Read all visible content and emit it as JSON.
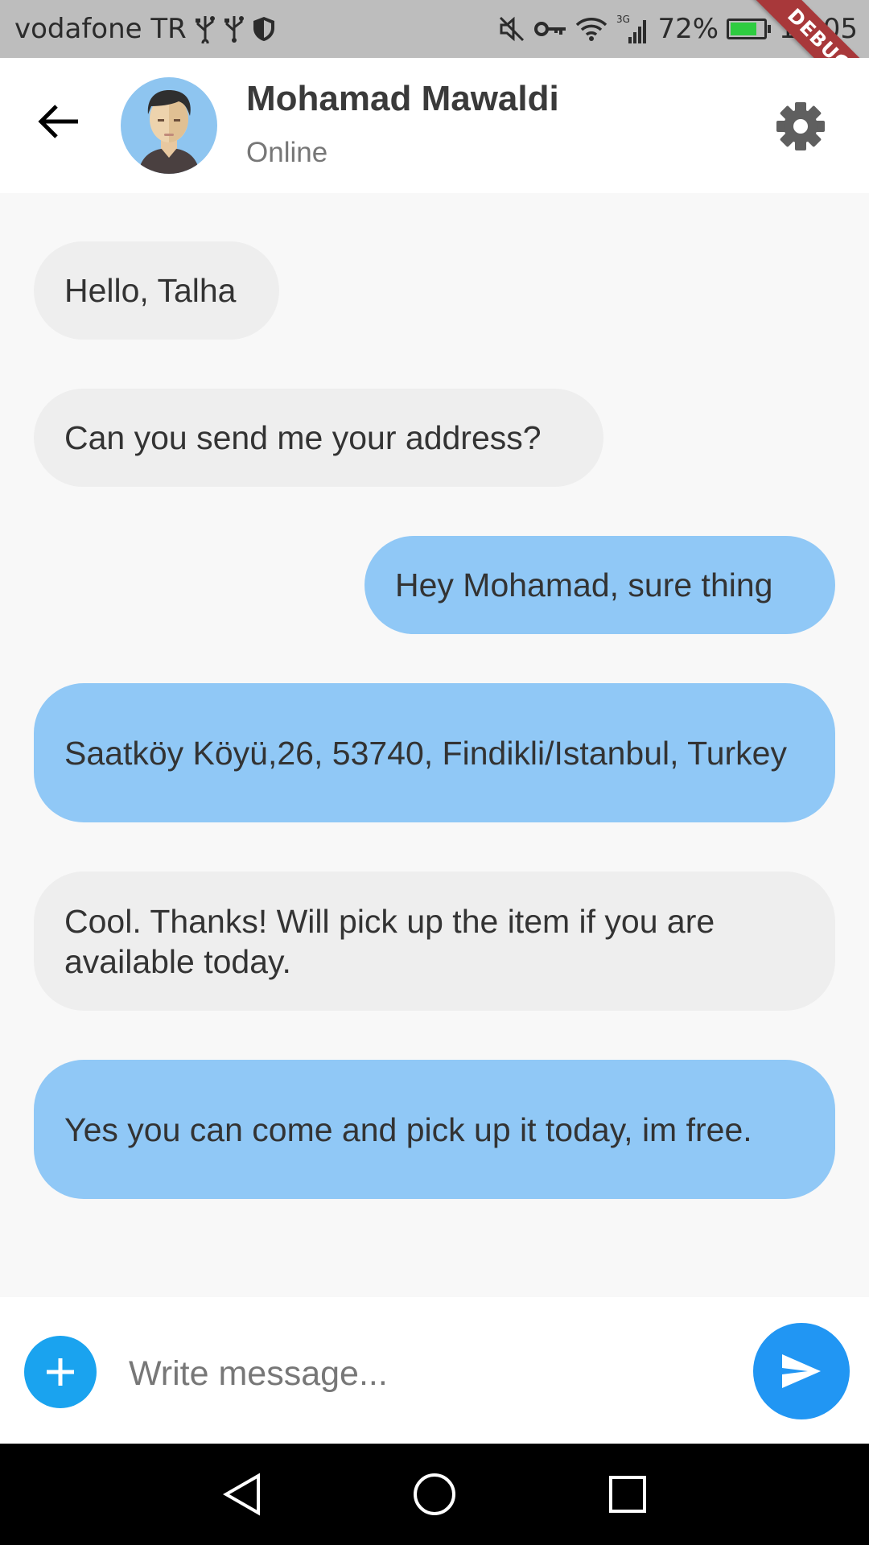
{
  "status_bar": {
    "carrier": "vodafone TR",
    "network_type": "3G",
    "battery": "72%",
    "battery_level": 0.72,
    "time": "19:05",
    "icons": [
      "usb-icon",
      "usb-icon",
      "shield-icon",
      "mute-icon",
      "key-icon",
      "wifi-icon",
      "signal-icon",
      "battery-icon"
    ]
  },
  "debug_banner": "DEBUG",
  "header": {
    "contact_name": "Mohamad Mawaldi",
    "contact_status": "Online",
    "icons": [
      "back-arrow-icon",
      "avatar",
      "settings-gear-icon"
    ]
  },
  "messages": [
    {
      "text": "Hello, Talha",
      "type": "received"
    },
    {
      "text": "Can you send me your address?",
      "type": "received"
    },
    {
      "text": "Hey Mohamad, sure thing",
      "type": "sent"
    },
    {
      "text": "Saatköy Köyü,26, 53740, Findikli/Istanbul, Turkey",
      "type": "sent"
    },
    {
      "text": "Cool. Thanks! Will pick up the item if you are available today.",
      "type": "received"
    },
    {
      "text": "Yes you can come and pick up it today, im free.",
      "type": "sent"
    }
  ],
  "composer": {
    "placeholder": "Write message...",
    "value": "",
    "icons": [
      "plus-icon",
      "send-icon"
    ]
  },
  "colors": {
    "received_bubble": "#eeeeee",
    "sent_bubble": "#90c8f6",
    "accent": "#2196f3",
    "add_button": "#1aa3ef",
    "debug_ribbon": "#a8383a"
  },
  "nav_bar": {
    "icons": [
      "back-triangle-icon",
      "home-circle-icon",
      "recents-square-icon"
    ]
  }
}
